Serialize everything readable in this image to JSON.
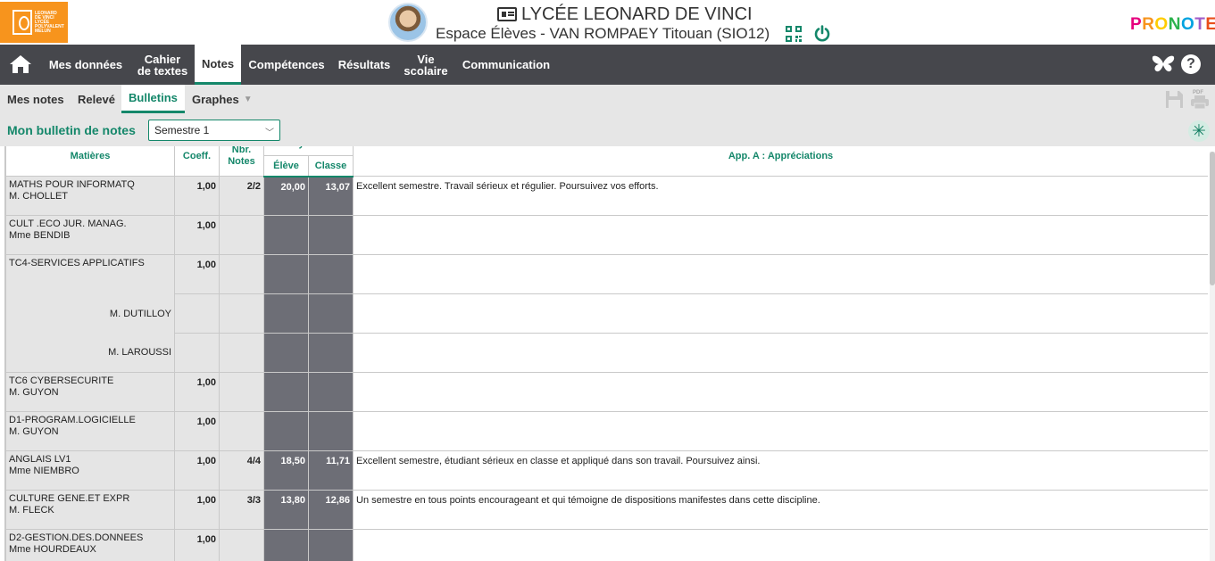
{
  "header": {
    "logo_text": "LEONARD DE VINCI LYCÉE POLYVALENT MELUN",
    "school_name": "LYCÉE LEONARD DE VINCI",
    "space_name": "Espace Élèves - VAN ROMPAEY Titouan (SIO12)",
    "brand": "PRONOTE",
    "brand_colors": [
      "#e6007e",
      "#f7941d",
      "#ffcc00",
      "#2bb24c",
      "#00a3e0",
      "#a05dc9",
      "#e94e1b"
    ]
  },
  "nav": {
    "items": [
      {
        "label": "Mes données"
      },
      {
        "label": "Cahier\nde textes"
      },
      {
        "label": "Notes"
      },
      {
        "label": "Compétences"
      },
      {
        "label": "Résultats"
      },
      {
        "label": "Vie\nscolaire"
      },
      {
        "label": "Communication"
      }
    ]
  },
  "subnav": {
    "items": [
      {
        "label": "Mes notes"
      },
      {
        "label": "Relevé"
      },
      {
        "label": "Bulletins"
      },
      {
        "label": "Graphes"
      }
    ]
  },
  "filter": {
    "title": "Mon bulletin de notes",
    "period": "Semestre 1",
    "star_label": "✳"
  },
  "table": {
    "headers": {
      "matieres": "Matières",
      "coeff": "Coeff.",
      "nbr_notes": "Nbr.\nNotes",
      "moyennes": "Moyennes",
      "eleve": "Élève",
      "classe": "Classe",
      "appreciations": "App. A : Appréciations"
    },
    "rows": [
      {
        "matiere": "MATHS POUR INFORMATQ",
        "prof": "M. CHOLLET",
        "coeff": "1,00",
        "nbr": "2/2",
        "eleve": "20,00",
        "classe": "13,07",
        "app": "Excellent semestre. Travail sérieux et régulier. Poursuivez vos efforts."
      },
      {
        "matiere": "CULT .ECO JUR. MANAG.",
        "prof": "Mme BENDIB",
        "coeff": "1,00",
        "nbr": "",
        "eleve": "",
        "classe": "",
        "app": ""
      },
      {
        "matiere": "TC4-SERVICES APPLICATIFS",
        "prof": "",
        "coeff": "1,00",
        "nbr": "",
        "eleve": "",
        "classe": "",
        "app": ""
      },
      {
        "matiere": "",
        "prof": "M. DUTILLOY",
        "coeff": "",
        "nbr": "",
        "eleve": "",
        "classe": "",
        "app": ""
      },
      {
        "matiere": "",
        "prof": "M. LAROUSSI",
        "coeff": "",
        "nbr": "",
        "eleve": "",
        "classe": "",
        "app": ""
      },
      {
        "matiere": "TC6 CYBERSECURITE",
        "prof": "M. GUYON",
        "coeff": "1,00",
        "nbr": "",
        "eleve": "",
        "classe": "",
        "app": ""
      },
      {
        "matiere": "D1-PROGRAM.LOGICIELLE",
        "prof": "M. GUYON",
        "coeff": "1,00",
        "nbr": "",
        "eleve": "",
        "classe": "",
        "app": ""
      },
      {
        "matiere": "ANGLAIS LV1",
        "prof": "Mme NIEMBRO",
        "coeff": "1,00",
        "nbr": "4/4",
        "eleve": "18,50",
        "classe": "11,71",
        "app": "Excellent semestre, étudiant sérieux en classe et appliqué dans son travail. Poursuivez ainsi."
      },
      {
        "matiere": "CULTURE GENE.ET EXPR",
        "prof": "M. FLECK",
        "coeff": "1,00",
        "nbr": "3/3",
        "eleve": "13,80",
        "classe": "12,86",
        "app": "Un semestre en tous points encourageant et qui témoigne de dispositions manifestes dans cette discipline."
      },
      {
        "matiere": "D2-GESTION.DES.DONNEES",
        "prof": "Mme HOURDEAUX",
        "coeff": "1,00",
        "nbr": "",
        "eleve": "",
        "classe": "",
        "app": ""
      }
    ]
  }
}
